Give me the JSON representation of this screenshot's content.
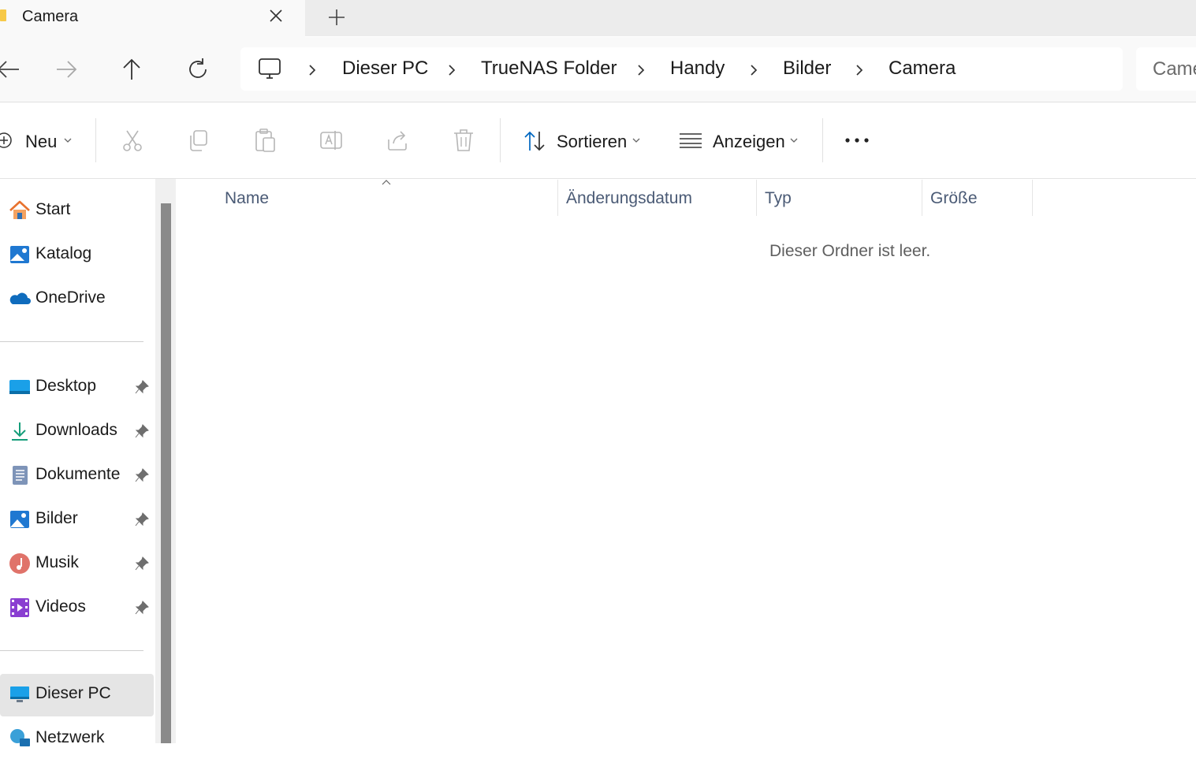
{
  "tab": {
    "title": "Camera"
  },
  "breadcrumb": [
    "Dieser PC",
    "TrueNAS Folder",
    "Handy",
    "Bilder",
    "Camera"
  ],
  "search": {
    "placeholder": "Came"
  },
  "toolbar": {
    "new_label": "Neu",
    "sort_label": "Sortieren",
    "view_label": "Anzeigen"
  },
  "sidebar": {
    "top": [
      {
        "label": "Start",
        "icon": "home-icon"
      },
      {
        "label": "Katalog",
        "icon": "gallery-icon"
      },
      {
        "label": "OneDrive",
        "icon": "onedrive-icon"
      }
    ],
    "pinned": [
      {
        "label": "Desktop",
        "icon": "desktop-icon"
      },
      {
        "label": "Downloads",
        "icon": "download-icon"
      },
      {
        "label": "Dokumente",
        "icon": "documents-icon"
      },
      {
        "label": "Bilder",
        "icon": "pictures-icon"
      },
      {
        "label": "Musik",
        "icon": "music-icon"
      },
      {
        "label": "Videos",
        "icon": "videos-icon"
      }
    ],
    "bottom": [
      {
        "label": "Dieser PC",
        "icon": "this-pc-icon"
      },
      {
        "label": "Netzwerk",
        "icon": "network-icon"
      }
    ]
  },
  "columns": [
    "Name",
    "Änderungsdatum",
    "Typ",
    "Größe"
  ],
  "empty_message": "Dieser Ordner ist leer.",
  "colors": {
    "accent": "#0067c0",
    "selection": "#e5e5e5",
    "folder": "#f7c948"
  }
}
